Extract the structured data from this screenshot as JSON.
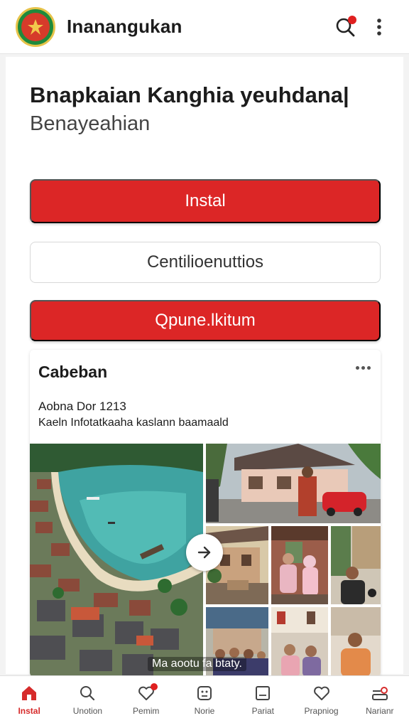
{
  "app": {
    "title": "Inanangukan"
  },
  "header": {
    "headline": "Bnapkaian Kanghia yeuhdana|",
    "subline": "Benayeahian"
  },
  "actions": {
    "install_label": "Instal",
    "secondary_label": "Centilioenuttios",
    "tertiary_label": "Qpune.lkitum"
  },
  "post": {
    "title": "Cabeban",
    "date": "Aobna Dor 1213",
    "description": "Kaeln Infotatkaaha kaslann baamaald",
    "gallery_caption": "Ma aootu fa btaty.",
    "photos": [
      "lagoon-aerial",
      "red-car-house",
      "woman-hijab-porch",
      "man-wooden-house",
      "family-group",
      "grandparents-house",
      "young-man"
    ]
  },
  "bottom_nav": {
    "items": [
      {
        "label": "Instal",
        "icon": "home-icon",
        "active": true
      },
      {
        "label": "Unotion",
        "icon": "search-icon",
        "active": false
      },
      {
        "label": "Pemim",
        "icon": "heart-icon",
        "active": false,
        "badge": true
      },
      {
        "label": "Norie",
        "icon": "dice-icon",
        "active": false
      },
      {
        "label": "Pariat",
        "icon": "book-icon",
        "active": false
      },
      {
        "label": "Prapniog",
        "icon": "heart-outline-icon",
        "active": false
      },
      {
        "label": "Narianr",
        "icon": "profile-icon",
        "active": false
      }
    ]
  },
  "colors": {
    "accent": "#dc2626",
    "logo_green": "#1f8a3c"
  }
}
